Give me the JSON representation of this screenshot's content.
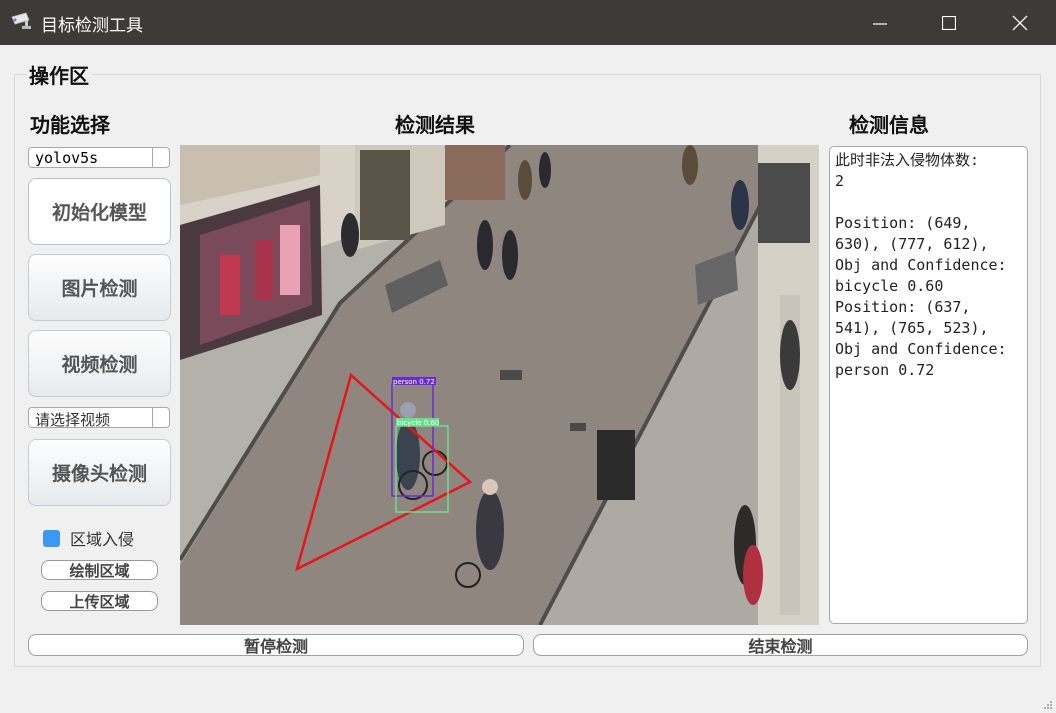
{
  "window": {
    "title": "目标检测工具",
    "icon": "camera-icon",
    "controls": [
      "minimize-icon",
      "maximize-icon",
      "close-icon"
    ]
  },
  "group": {
    "title": "操作区"
  },
  "left_panel": {
    "heading": "功能选择",
    "model_select": "yolov5s",
    "init_model": "初始化模型",
    "image_detect": "图片检测",
    "video_detect": "视频检测",
    "video_select_placeholder": "请选择视频",
    "camera_detect": "摄像头检测",
    "region_intrusion": {
      "label": "区域入侵",
      "checked": true
    },
    "draw_region": "绘制区域",
    "upload_region": "上传区域"
  },
  "center_panel": {
    "heading": "检测结果",
    "detections": [
      {
        "label": "person 0.72"
      },
      {
        "label": "bicycle 0.60"
      }
    ]
  },
  "right_panel": {
    "heading": "检测信息",
    "info_text": "此时非法入侵物体数:\n2\n\nPosition: (649,\n630), (777, 612),\nObj and Confidence:\nbicycle 0.60\nPosition: (637,\n541), (765, 523),\nObj and Confidence:\nperson 0.72"
  },
  "bottom": {
    "pause": "暂停检测",
    "stop": "结束检测"
  },
  "colors": {
    "titlebar": "#3c3b37",
    "checkbox": "#3a99f0",
    "region_line": "#e8141a",
    "person_box": "#6b2bd6",
    "bicycle_box": "#66e08a"
  }
}
